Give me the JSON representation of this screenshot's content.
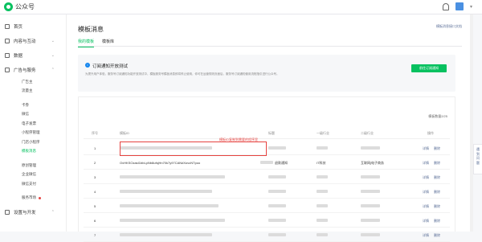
{
  "app": {
    "name": "公众号"
  },
  "sidebar": {
    "groups": [
      {
        "label": "首页"
      },
      {
        "label": "内容与互动"
      },
      {
        "label": "数据"
      },
      {
        "label": "广告与服务"
      }
    ],
    "subs": [
      {
        "label": "广告主"
      },
      {
        "label": "流量主"
      },
      {
        "label": "卡券"
      },
      {
        "label": "微信"
      },
      {
        "label": "电子发票"
      },
      {
        "label": "小程序管理"
      },
      {
        "label": "门店小程序"
      },
      {
        "label": "模板消息",
        "active": true
      },
      {
        "label": "原创管理"
      },
      {
        "label": "企业微信"
      },
      {
        "label": "微信支付"
      },
      {
        "label": "服务市场"
      }
    ],
    "bottom_group": {
      "label": "设置与开发"
    }
  },
  "page": {
    "title": "模板消息",
    "help_link": "模板消息接口文档",
    "tabs": [
      {
        "label": "我的模板",
        "active": true
      },
      {
        "label": "模板库"
      }
    ]
  },
  "notice": {
    "title": "订阅通知开放测试",
    "description": "为提升用户体验，服务号订阅通知功能开放测试中，模板服务号模板消息即将停止使用，你可在运营规则页面后，服务号订阅通知使用流程指引进行公众号。",
    "button": "前往订阅通知"
  },
  "table": {
    "count_label": "模板数量2/25",
    "headers": [
      "序号",
      "模板ID",
      "标题",
      "一级行业",
      "二级行业",
      "操作"
    ],
    "rows": [
      {
        "index": "1",
        "template_id": "",
        "title": "",
        "industry1": "",
        "industry2": ""
      },
      {
        "index": "2",
        "template_id": "OvHKSOzasI1bbLpNb8ufsjHn70k7y97CANdXovcNTpoo",
        "title": "退款通知",
        "industry1": "IT科技",
        "industry2": "互联网|电子商务"
      },
      {
        "index": "3",
        "template_id": "",
        "title": "",
        "industry1": "",
        "industry2": ""
      },
      {
        "index": "4",
        "template_id": "",
        "title": "",
        "industry1": "",
        "industry2": ""
      },
      {
        "index": "5",
        "template_id": "",
        "title": "",
        "industry1": "",
        "industry2": ""
      },
      {
        "index": "6",
        "template_id": "",
        "title": "",
        "industry1": "",
        "industry2": ""
      },
      {
        "index": "7",
        "template_id": "",
        "title": "",
        "industry1": "",
        "industry2": ""
      }
    ],
    "action_detail": "详情",
    "action_delete": "删除"
  },
  "annotation": "模板ID复制到需要的程序里",
  "float_button": "遇到问题"
}
